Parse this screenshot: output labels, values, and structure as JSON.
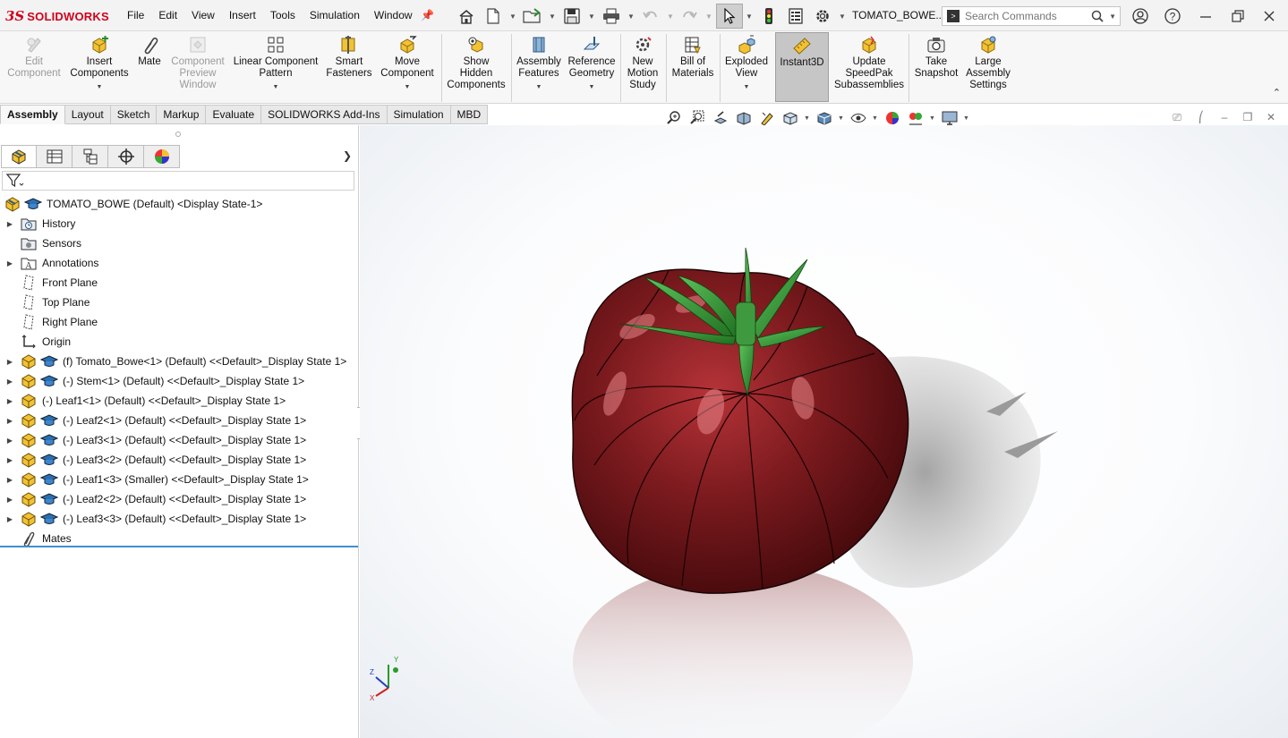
{
  "app": {
    "brand": "SOLIDWORKS",
    "logo_mark": "3S",
    "document_title": "TOMATO_BOWE....",
    "menu": [
      "File",
      "Edit",
      "View",
      "Insert",
      "Tools",
      "Simulation",
      "Window"
    ],
    "search_placeholder": "Search Commands",
    "accent_color": "#d0021b"
  },
  "quick_access_icons": [
    "home-icon",
    "new-document-icon",
    "open-folder-icon",
    "save-icon",
    "print-icon",
    "undo-icon",
    "redo-icon",
    "select-pointer-icon",
    "rebuild-traffic-light-icon",
    "file-properties-icon",
    "options-gear-icon"
  ],
  "command_manager": {
    "commands": [
      {
        "id": "edit-component",
        "label": [
          "Edit",
          "Component"
        ],
        "disabled": true
      },
      {
        "id": "insert-components",
        "label": [
          "Insert",
          "Components"
        ],
        "disabled": false
      },
      {
        "id": "mate",
        "label": [
          "Mate"
        ],
        "disabled": false
      },
      {
        "id": "component-preview-window",
        "label": [
          "Component",
          "Preview",
          "Window"
        ],
        "disabled": true
      },
      {
        "id": "linear-component-pattern",
        "label": [
          "Linear Component",
          "Pattern"
        ],
        "disabled": false
      },
      {
        "id": "smart-fasteners",
        "label": [
          "Smart",
          "Fasteners"
        ],
        "disabled": false
      },
      {
        "id": "move-component",
        "label": [
          "Move",
          "Component"
        ],
        "disabled": false
      },
      {
        "id": "show-hidden-components",
        "label": [
          "Show",
          "Hidden",
          "Components"
        ],
        "disabled": false
      },
      {
        "id": "assembly-features",
        "label": [
          "Assembly",
          "Features"
        ],
        "disabled": false
      },
      {
        "id": "reference-geometry",
        "label": [
          "Reference",
          "Geometry"
        ],
        "disabled": false
      },
      {
        "id": "new-motion-study",
        "label": [
          "New",
          "Motion",
          "Study"
        ],
        "disabled": false
      },
      {
        "id": "bill-of-materials",
        "label": [
          "Bill of",
          "Materials"
        ],
        "disabled": false
      },
      {
        "id": "exploded-view",
        "label": [
          "Exploded",
          "View"
        ],
        "disabled": false
      },
      {
        "id": "instant3d",
        "label": [
          "Instant3D"
        ],
        "disabled": false
      },
      {
        "id": "update-speedpak",
        "label": [
          "Update",
          "SpeedPak",
          "Subassemblies"
        ],
        "disabled": false
      },
      {
        "id": "take-snapshot",
        "label": [
          "Take",
          "Snapshot"
        ],
        "disabled": false
      },
      {
        "id": "large-assembly-settings",
        "label": [
          "Large",
          "Assembly",
          "Settings"
        ],
        "disabled": false
      }
    ]
  },
  "tabs": [
    "Assembly",
    "Layout",
    "Sketch",
    "Markup",
    "Evaluate",
    "SOLIDWORKS Add-Ins",
    "Simulation",
    "MBD"
  ],
  "active_tab": "Assembly",
  "feature_tree": {
    "panel_tabs": [
      "featuremanager-icon",
      "propertymanager-icon",
      "configurationmanager-icon",
      "dimxpert-icon",
      "display-manager-icon"
    ],
    "root": "TOMATO_BOWE (Default) <Display State-1>",
    "items": [
      {
        "label": "History",
        "icon": "history-folder-icon",
        "expandable": true
      },
      {
        "label": "Sensors",
        "icon": "sensors-folder-icon",
        "expandable": false
      },
      {
        "label": "Annotations",
        "icon": "annotations-icon",
        "expandable": true
      },
      {
        "label": "Front Plane",
        "icon": "plane-icon",
        "expandable": false
      },
      {
        "label": "Top Plane",
        "icon": "plane-icon",
        "expandable": false
      },
      {
        "label": "Right Plane",
        "icon": "plane-icon",
        "expandable": false
      },
      {
        "label": "Origin",
        "icon": "origin-icon",
        "expandable": false
      },
      {
        "label": "(f) Tomato_Bowe<1> (Default) <<Default>_Display State 1>",
        "icon": "part-icon",
        "expandable": true,
        "display_state": true
      },
      {
        "label": "(-) Stem<1> (Default) <<Default>_Display State 1>",
        "icon": "part-icon",
        "expandable": true,
        "display_state": true
      },
      {
        "label": "(-) Leaf1<1> (Default) <<Default>_Display State 1>",
        "icon": "part-icon",
        "expandable": true,
        "display_state": false
      },
      {
        "label": "(-) Leaf2<1> (Default) <<Default>_Display State 1>",
        "icon": "part-icon",
        "expandable": true,
        "display_state": true
      },
      {
        "label": "(-) Leaf3<1> (Default) <<Default>_Display State 1>",
        "icon": "part-icon",
        "expandable": true,
        "display_state": true
      },
      {
        "label": "(-) Leaf3<2> (Default) <<Default>_Display State 1>",
        "icon": "part-icon",
        "expandable": true,
        "display_state": true
      },
      {
        "label": "(-) Leaf1<3> (Smaller) <<Default>_Display State 1>",
        "icon": "part-icon",
        "expandable": true,
        "display_state": true
      },
      {
        "label": "(-) Leaf2<2> (Default) <<Default>_Display State 1>",
        "icon": "part-icon",
        "expandable": true,
        "display_state": true
      },
      {
        "label": "(-) Leaf3<3> (Default) <<Default>_Display State 1>",
        "icon": "part-icon",
        "expandable": true,
        "display_state": true
      },
      {
        "label": "Mates",
        "icon": "mates-icon",
        "expandable": false
      }
    ]
  },
  "view_toolbar_icons": [
    "zoom-to-fit-icon",
    "zoom-to-area-icon",
    "previous-view-icon",
    "section-view-icon",
    "dynamic-annotation-icon",
    "view-orientation-icon",
    "display-style-icon",
    "hide-show-items-icon",
    "edit-appearance-icon",
    "apply-scene-icon",
    "view-settings-icon"
  ],
  "task_pane_icons": [
    "solidworks-resources-icon",
    "design-library-icon",
    "file-explorer-icon",
    "view-palette-icon",
    "appearances-scenes-icon",
    "custom-properties-icon"
  ],
  "model": {
    "body_color": "#7a1a1c",
    "stem_color": "#2e8b2e"
  },
  "triad": {
    "x": "X",
    "y": "Y",
    "z": "Z"
  }
}
